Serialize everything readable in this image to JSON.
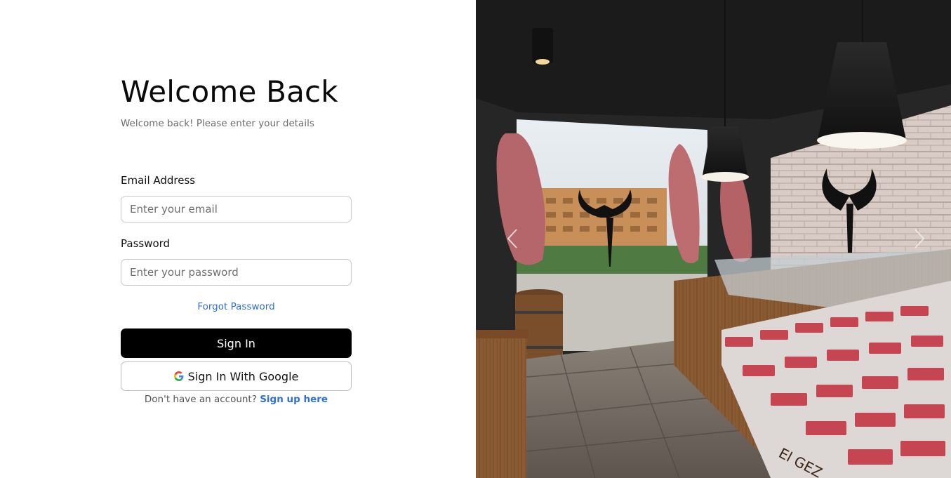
{
  "login": {
    "title": "Welcome Back",
    "subtitle": "Welcome back! Please enter your details",
    "email_label": "Email Address",
    "email_placeholder": "Enter your email",
    "password_label": "Password",
    "password_placeholder": "Enter your password",
    "forgot_password": "Forgot Password",
    "sign_in": "Sign In",
    "google_sign_in": "Sign In With Google",
    "no_account_text": "Don't have an account?",
    "sign_up_link": "Sign up here"
  },
  "hero": {
    "image": "butcher-shop-interior-photo",
    "prev_icon": "chevron-left-icon",
    "next_icon": "chevron-right-icon",
    "storefront_text": "El GEZ"
  },
  "colors": {
    "primary_button": "#000000",
    "link": "#2f6fdb",
    "input_border": "#c9c9c9"
  }
}
